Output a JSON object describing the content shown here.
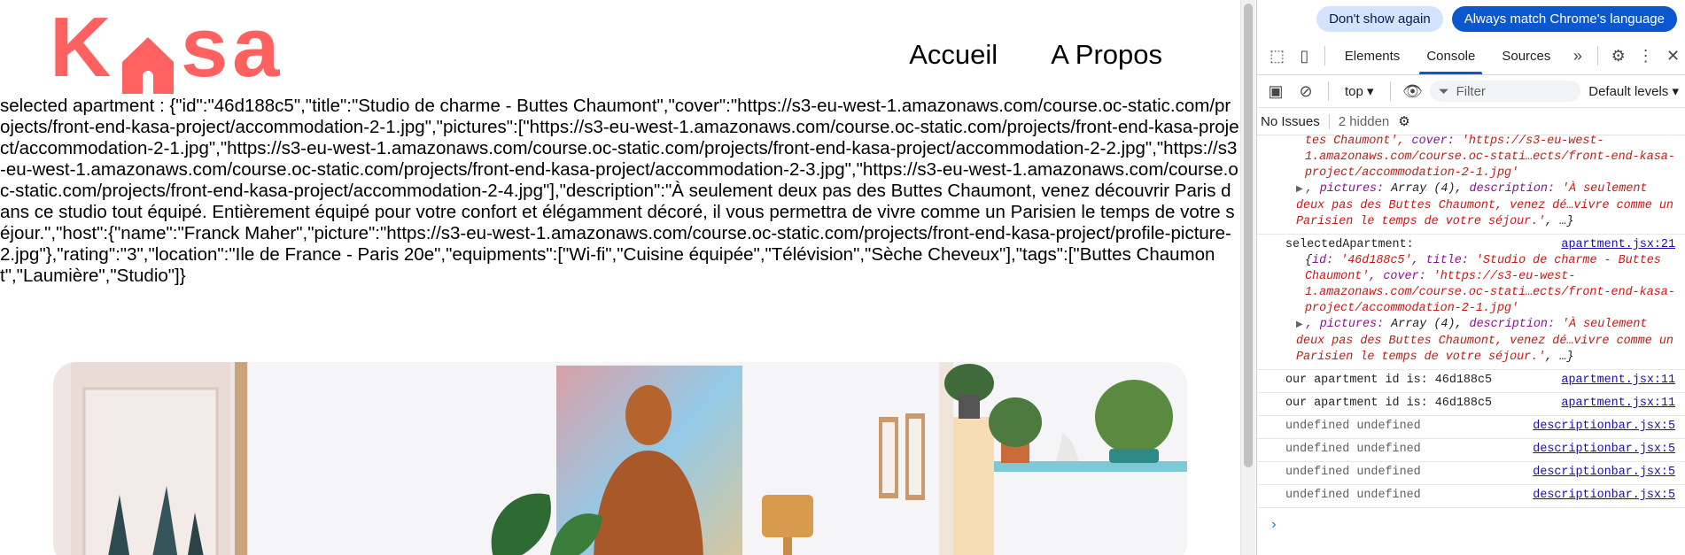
{
  "site": {
    "logo_letters": [
      "K",
      "s",
      "a"
    ],
    "nav": [
      "Accueil",
      "A Propos"
    ],
    "debug_text": "selected apartment : {\"id\":\"46d188c5\",\"title\":\"Studio de charme - Buttes Chaumont\",\"cover\":\"https://s3-eu-west-1.amazonaws.com/course.oc-static.com/projects/front-end-kasa-project/accommodation-2-1.jpg\",\"pictures\":[\"https://s3-eu-west-1.amazonaws.com/course.oc-static.com/projects/front-end-kasa-project/accommodation-2-1.jpg\",\"https://s3-eu-west-1.amazonaws.com/course.oc-static.com/projects/front-end-kasa-project/accommodation-2-2.jpg\",\"https://s3-eu-west-1.amazonaws.com/course.oc-static.com/projects/front-end-kasa-project/accommodation-2-3.jpg\",\"https://s3-eu-west-1.amazonaws.com/course.oc-static.com/projects/front-end-kasa-project/accommodation-2-4.jpg\"],\"description\":\"À seulement deux pas des Buttes Chaumont, venez découvrir Paris dans ce studio tout équipé. Entièrement équipé pour votre confort et élégamment décoré, il vous permettra de vivre comme un Parisien le temps de votre séjour.\",\"host\":{\"name\":\"Franck Maher\",\"picture\":\"https://s3-eu-west-1.amazonaws.com/course.oc-static.com/projects/front-end-kasa-project/profile-picture-2.jpg\"},\"rating\":\"3\",\"location\":\"Ile de France - Paris 20e\",\"equipments\":[\"Wi-fi\",\"Cuisine équipée\",\"Télévision\",\"Sèche Cheveux\"],\"tags\":[\"Buttes Chaumont\",\"Laumière\",\"Studio\"]}",
    "colors": {
      "brand": "#FF6060"
    }
  },
  "devtools": {
    "language_bar": {
      "dont_show": "Don't show again",
      "always_match": "Always match Chrome's language"
    },
    "tabs": [
      "Elements",
      "Console",
      "Sources"
    ],
    "active_tab": "Console",
    "toolbar": {
      "context": "top",
      "filter_placeholder": "Filter",
      "levels": "Default levels"
    },
    "issues": {
      "no_issues": "No Issues",
      "hidden": "2 hidden"
    },
    "log": {
      "entry1": {
        "line1_key": "tes Chaumont', ",
        "cover_key": "cover: ",
        "cover_val": "'https://s3-eu-west-1.amazonaws.com/course.oc-stati…ects/front-end-kasa-project/accommodation-2-1.jpg'",
        "pictures_key": ", pictures: ",
        "pictures_val": "Array (4), ",
        "desc_key": "description: ",
        "desc_val": "'À seulement deux pas des Buttes Chaumont, venez dé…vivre comme un Parisien le temps de votre séjour.'",
        "ellipsis": ", …}"
      },
      "entry2": {
        "label": "selectedApartment:",
        "source": "apartment.jsx:21",
        "id_key": "id: ",
        "id_val": "'46d188c5'",
        "title_key": ", title: ",
        "title_val": "'Studio de charme - Buttes Chaumont'",
        "cover_key": ", cover: ",
        "cover_val": "'https://s3-eu-west-1.amazonaws.com/course.oc-stati…ects/front-end-kasa-project/accommodation-2-1.jpg'",
        "pictures_key": ", pictures: ",
        "pictures_val": "Array (4), ",
        "desc_key": "description: ",
        "desc_val": "'À seulement deux pas des Buttes Chaumont, venez dé…vivre comme un Parisien le temps de votre séjour.'",
        "ellipsis": ", …}"
      },
      "entries": [
        {
          "text": "our apartment id is: 46d188c5",
          "source": "apartment.jsx:11"
        },
        {
          "text": "our apartment id is: 46d188c5",
          "source": "apartment.jsx:11"
        },
        {
          "text": "undefined undefined",
          "source": "descriptionbar.jsx:5"
        },
        {
          "text": "undefined undefined",
          "source": "descriptionbar.jsx:5"
        },
        {
          "text": "undefined undefined",
          "source": "descriptionbar.jsx:5"
        },
        {
          "text": "undefined undefined",
          "source": "descriptionbar.jsx:5"
        }
      ],
      "prompt": "›"
    }
  }
}
